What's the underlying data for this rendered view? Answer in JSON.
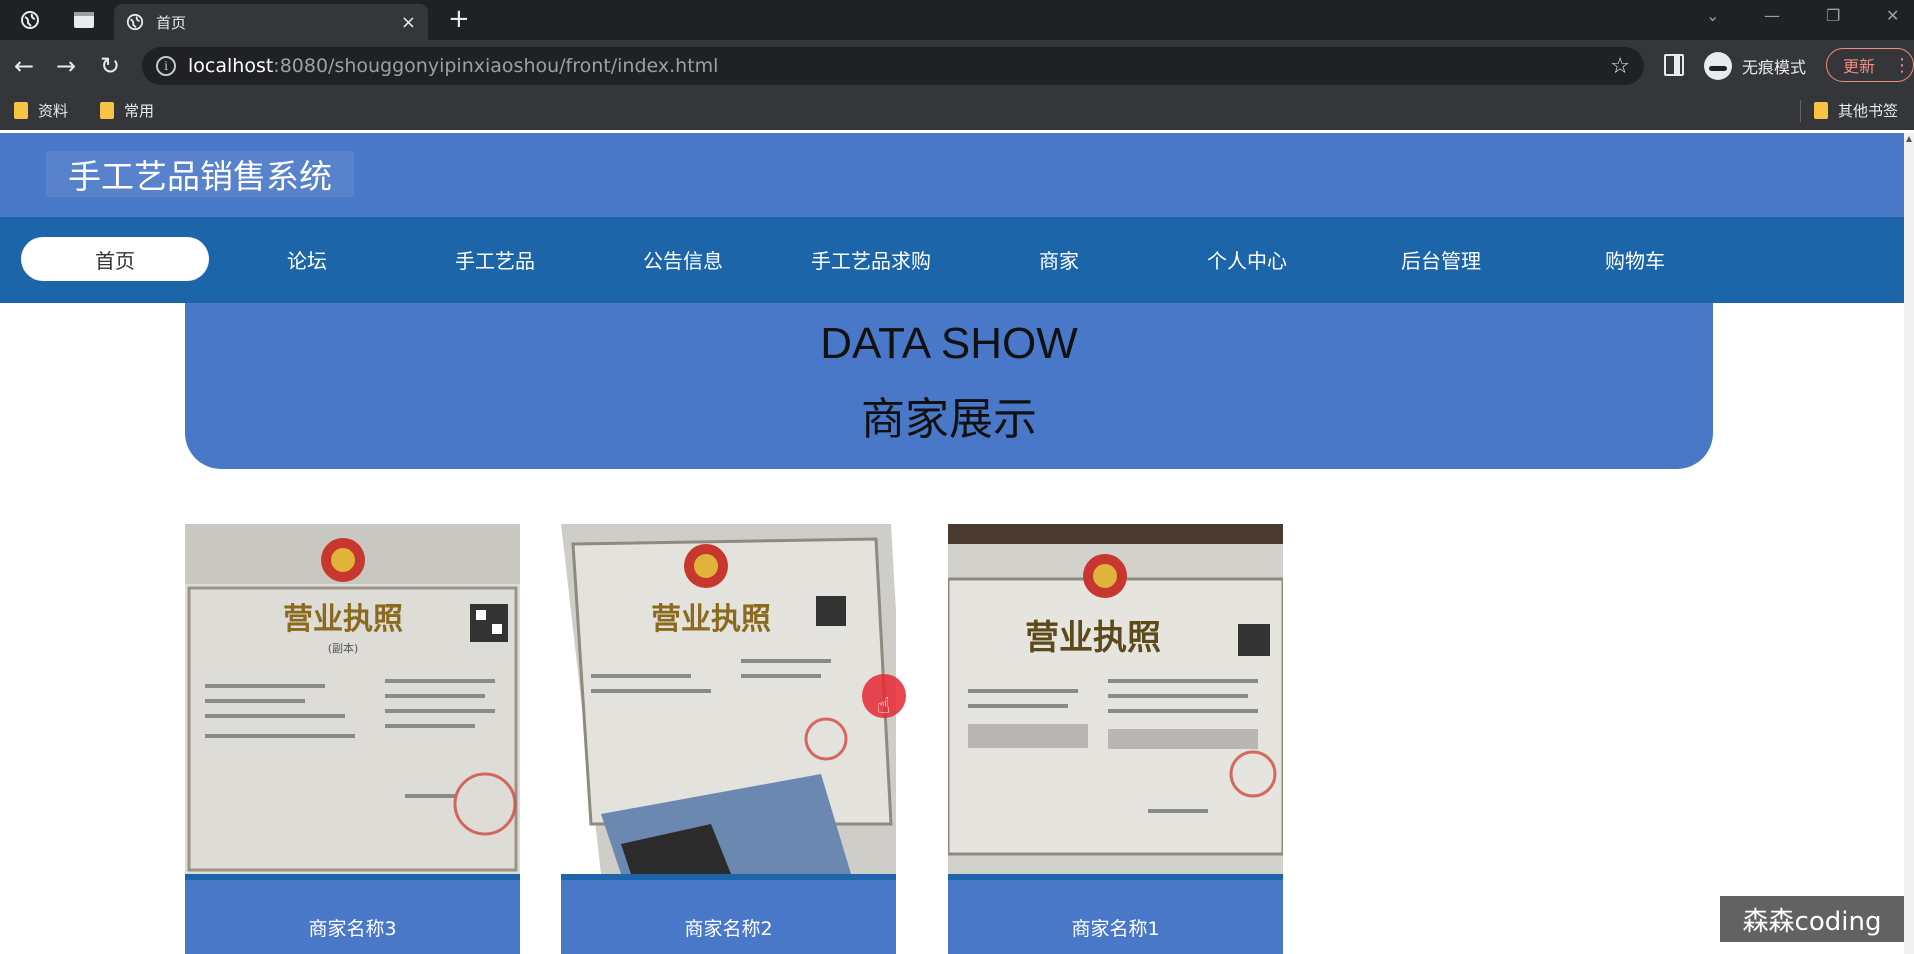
{
  "browser": {
    "tab_title": "首页",
    "tab_close": "×",
    "new_tab": "+",
    "url_host": "localhost",
    "url_path": ":8080/shouggonyipinxiaoshou/front/index.html",
    "incognito_label": "无痕模式",
    "update_label": "更新",
    "bookmarks": [
      "资料",
      "常用"
    ],
    "other_bookmarks": "其他书签"
  },
  "site": {
    "title": "手工艺品销售系统",
    "nav": [
      {
        "label": "首页",
        "active": true
      },
      {
        "label": "论坛"
      },
      {
        "label": "手工艺品"
      },
      {
        "label": "公告信息"
      },
      {
        "label": "手工艺品求购"
      },
      {
        "label": "商家"
      },
      {
        "label": "个人中心"
      },
      {
        "label": "后台管理"
      },
      {
        "label": "购物车"
      }
    ]
  },
  "banner": {
    "en": "DATA SHOW",
    "zh": "商家展示"
  },
  "merchants": [
    {
      "name": "商家名称3"
    },
    {
      "name": "商家名称2"
    },
    {
      "name": "商家名称1"
    }
  ],
  "license_text": {
    "title": "营业执照",
    "subtitle": "(副本)"
  },
  "watermark": "森森coding",
  "colors": {
    "header": "#4a78c8",
    "navbar": "#1c65a8",
    "chrome_dark": "#202124",
    "chrome": "#35363a"
  }
}
